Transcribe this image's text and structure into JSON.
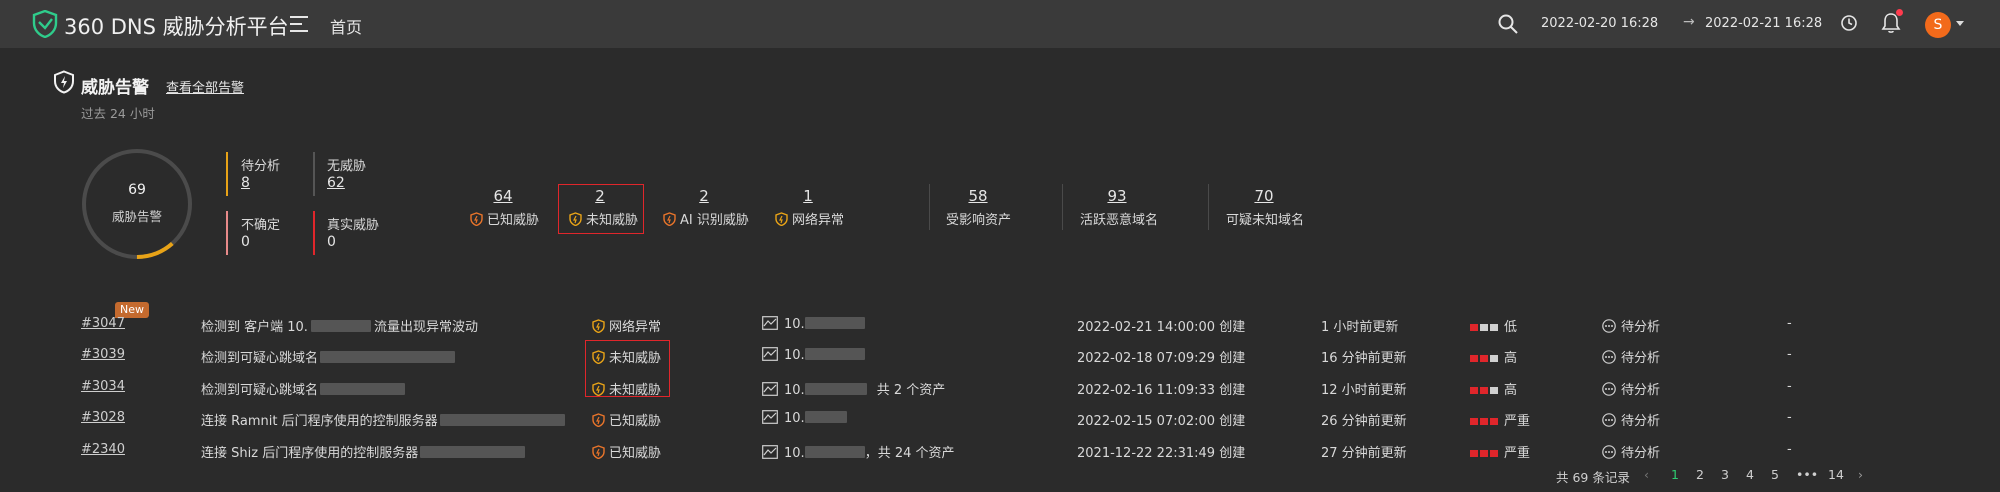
{
  "header": {
    "title": "360 DNS 威胁分析平台",
    "nav_home": "首页",
    "date_start": "2022-02-20 16:28",
    "arrow": "→",
    "date_end": "2022-02-21 16:28",
    "avatar_initial": "S",
    "icons": [
      "logo-shield-icon",
      "menu-icon",
      "search-icon",
      "clock-icon",
      "bell-icon",
      "chevron-down-icon"
    ]
  },
  "section": {
    "title": "威胁告警",
    "view_all": "查看全部告警",
    "subtitle": "过去 24 小时"
  },
  "summary": {
    "total": "69",
    "total_label": "威胁告警",
    "pending_label": "待分析",
    "pending_value": "8",
    "no_threat_label": "无威胁",
    "no_threat_value": "62",
    "uncertain_label": "不确定",
    "uncertain_value": "0",
    "real_label": "真实威胁",
    "real_value": "0",
    "donut_fraction": 0.116
  },
  "metrics": [
    {
      "value": "64",
      "label": "已知威胁"
    },
    {
      "value": "2",
      "label": "未知威胁"
    },
    {
      "value": "2",
      "label": "AI 识别威胁"
    },
    {
      "value": "1",
      "label": "网络异常"
    },
    {
      "value": "58",
      "label": "受影响资产"
    },
    {
      "value": "93",
      "label": "活跃恶意域名"
    },
    {
      "value": "70",
      "label": "可疑未知域名"
    }
  ],
  "new_badge": "New",
  "rows": [
    {
      "id": "#3047",
      "title": "检测到 客户端 10.",
      "title_suffix": "流量出现异常波动",
      "type": "网络异常",
      "asset": "10.",
      "asset_extra": "",
      "created": "2022-02-21 14:00:00 创建",
      "updated": "1 小时前更新",
      "severity": "低",
      "sev_level": 1,
      "status": "待分析",
      "extra": "-"
    },
    {
      "id": "#3039",
      "title": "检测到可疑心跳域名",
      "title_suffix": "",
      "type": "未知威胁",
      "asset": "10.",
      "asset_extra": "",
      "created": "2022-02-18 07:09:29 创建",
      "updated": "16 分钟前更新",
      "severity": "高",
      "sev_level": 2,
      "status": "待分析",
      "extra": "-"
    },
    {
      "id": "#3034",
      "title": "检测到可疑心跳域名",
      "title_suffix": "",
      "type": "未知威胁",
      "asset": "10.",
      "asset_extra": "共 2 个资产",
      "created": "2022-02-16 11:09:33 创建",
      "updated": "12 小时前更新",
      "severity": "高",
      "sev_level": 2,
      "status": "待分析",
      "extra": "-"
    },
    {
      "id": "#3028",
      "title": "连接 Ramnit 后门程序使用的控制服务器",
      "title_suffix": "",
      "type": "已知威胁",
      "asset": "10.",
      "asset_extra": "",
      "created": "2022-02-15 07:02:00 创建",
      "updated": "26 分钟前更新",
      "severity": "严重",
      "sev_level": 3,
      "status": "待分析",
      "extra": "-"
    },
    {
      "id": "#2340",
      "title": "连接 Shiz 后门程序使用的控制服务器",
      "title_suffix": "",
      "type": "已知威胁",
      "asset": "10.",
      "asset_extra": "，共 24 个资产",
      "created": "2021-12-22 22:31:49 创建",
      "updated": "27 分钟前更新",
      "severity": "严重",
      "sev_level": 3,
      "status": "待分析",
      "extra": "-"
    }
  ],
  "pagination": {
    "total_text": "共 69 条记录",
    "prev": "‹",
    "pages": [
      "1",
      "2",
      "3",
      "4",
      "5"
    ],
    "ellipsis": "•••",
    "last": "14",
    "next": "›",
    "current": "1"
  },
  "colors": {
    "accent_orange": "#e8a317",
    "severity_red": "#e0262b",
    "severity_gray": "#d0d0d0",
    "page_active": "#2ecc71",
    "highlight_box": "#e0262b"
  }
}
